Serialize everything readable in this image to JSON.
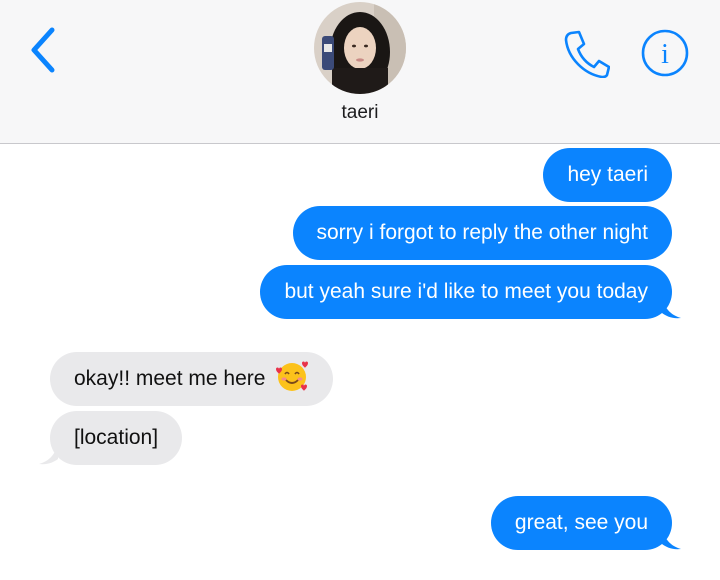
{
  "header": {
    "back_icon": "chevron-left-icon",
    "contact_name": "taeri",
    "avatar_icon": "contact-photo",
    "call_icon": "phone-icon",
    "info_icon": "info-icon",
    "accent_color": "#0b84fe"
  },
  "messages": [
    {
      "from": "me",
      "text": "hey taeri"
    },
    {
      "from": "me",
      "text": "sorry i forgot to reply the other night"
    },
    {
      "from": "me",
      "text": "but yeah sure i'd like to meet you today"
    },
    {
      "from": "them",
      "text": "okay!! meet me here",
      "emoji": "smiling-face-with-hearts"
    },
    {
      "from": "them",
      "text": "[location]"
    },
    {
      "from": "me",
      "text": "great, see you"
    }
  ],
  "colors": {
    "sent_bubble": "#0b84fe",
    "received_bubble": "#e9e9eb",
    "header_bg": "#f7f7f8"
  }
}
